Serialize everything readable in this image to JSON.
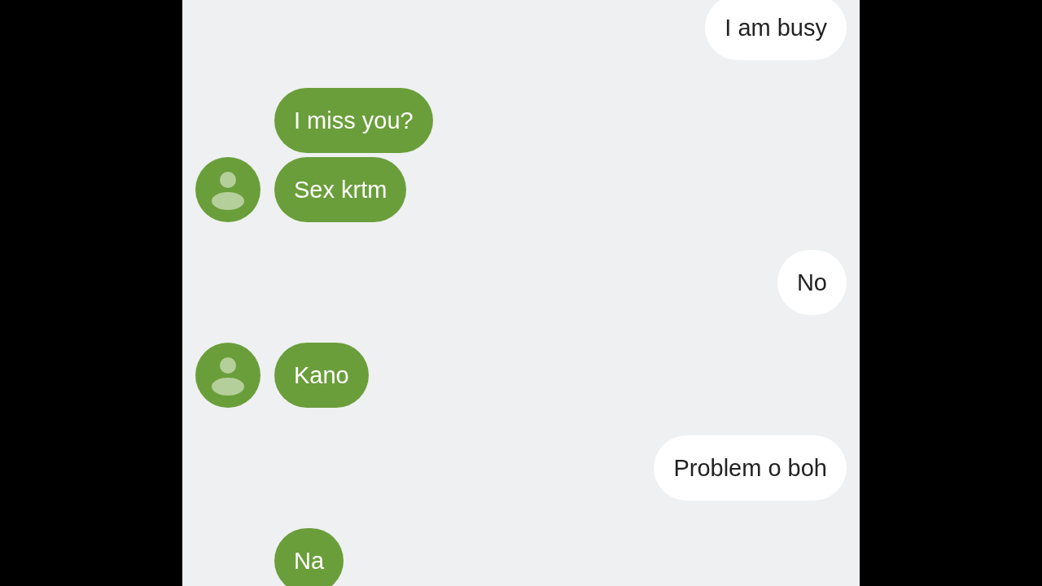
{
  "messages": [
    {
      "kind": "outgoing",
      "text": "I am busy",
      "avatar": false
    },
    {
      "kind": "incoming",
      "text": "I miss you?",
      "avatar": false
    },
    {
      "kind": "incoming",
      "text": "Sex krtm",
      "avatar": true
    },
    {
      "kind": "outgoing",
      "text": "No",
      "avatar": false
    },
    {
      "kind": "incoming",
      "text": "Kano",
      "avatar": true
    },
    {
      "kind": "outgoing",
      "text": "Problem o boh",
      "avatar": false
    },
    {
      "kind": "incoming",
      "text": "Na",
      "avatar": false
    }
  ]
}
